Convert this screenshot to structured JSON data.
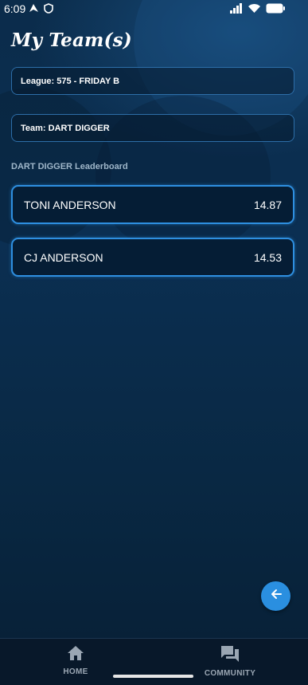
{
  "status_bar": {
    "time": "6:09"
  },
  "page": {
    "title": "My Team(s)",
    "league_field": "League: 575 - FRIDAY B",
    "team_field": "Team: DART DIGGER",
    "leaderboard_label": "DART DIGGER Leaderboard"
  },
  "leaderboard": [
    {
      "name": "TONI ANDERSON",
      "score": "14.87"
    },
    {
      "name": "CJ ANDERSON",
      "score": "14.53"
    }
  ],
  "nav": {
    "home": "HOME",
    "community": "COMMUNITY"
  },
  "icons": {
    "back": "arrow-left-icon",
    "home": "home-icon",
    "community": "forum-icon"
  },
  "colors": {
    "accent": "#2a8fe0",
    "background": "#0b2c4b",
    "nav_label": "#9aa6b3"
  }
}
